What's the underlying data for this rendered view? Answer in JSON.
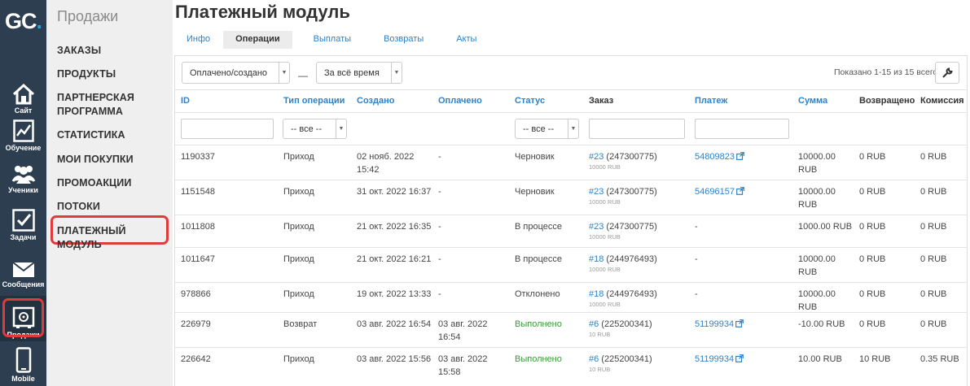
{
  "app": {
    "logo_g": "G",
    "logo_c": "C",
    "logo_dot": "."
  },
  "rail": [
    {
      "label": "Сайт",
      "icon": "house-icon"
    },
    {
      "label": "Обучение",
      "icon": "chart-icon"
    },
    {
      "label": "Ученики",
      "icon": "users-icon"
    },
    {
      "label": "Задачи",
      "icon": "checkbox-icon"
    },
    {
      "label": "Сообщения",
      "icon": "envelope-icon"
    },
    {
      "label": "Продажи",
      "icon": "safe-icon"
    },
    {
      "label": "Mobile",
      "icon": "phone-icon"
    }
  ],
  "menu": {
    "title": "Продажи",
    "items": [
      "ЗАКАЗЫ",
      "ПРОДУКТЫ",
      "ПАРТНЕРСКАЯ ПРОГРАММА",
      "СТАТИСТИКА",
      "МОИ ПОКУПКИ",
      "ПРОМОАКЦИИ",
      "ПОТОКИ",
      "ПЛАТЕЖНЫЙ МОДУЛЬ"
    ]
  },
  "page": {
    "title": "Платежный модуль"
  },
  "tabs": [
    "Инфо",
    "Операции",
    "Выплаты",
    "Возвраты",
    "Акты"
  ],
  "filters": {
    "status": "Оплачено/создано",
    "dash": "—",
    "period": "За всё время",
    "shown": "Показано 1-15 из 15 всего."
  },
  "table": {
    "headers": [
      "ID",
      "Тип операции",
      "Создано",
      "Оплачено",
      "Статус",
      "Заказ",
      "Платеж",
      "Сумма",
      "Возвращено",
      "Комиссия"
    ],
    "filter_type": "-- все --",
    "filter_status": "-- все --",
    "rows": [
      {
        "id": "1190337",
        "type": "Приход",
        "created1": "02 нояб. 2022",
        "created2": "15:42",
        "paid1": "-",
        "paid2": "",
        "status": "Черновик",
        "order": "#23",
        "order_rest": " (247300775)",
        "order_sub": "10000 RUB",
        "payment": "54809823",
        "sum1": "10000.00",
        "sum2": "RUB",
        "returned": "0 RUB",
        "commission": "0 RUB"
      },
      {
        "id": "1151548",
        "type": "Приход",
        "created1": "31 окт. 2022 16:37",
        "created2": "",
        "paid1": "-",
        "paid2": "",
        "status": "Черновик",
        "order": "#23",
        "order_rest": " (247300775)",
        "order_sub": "10000 RUB",
        "payment": "54696157",
        "sum1": "10000.00",
        "sum2": "RUB",
        "returned": "0 RUB",
        "commission": "0 RUB"
      },
      {
        "id": "1011808",
        "type": "Приход",
        "created1": "21 окт. 2022 16:35",
        "created2": "",
        "paid1": "-",
        "paid2": "",
        "status": "В процессе",
        "order": "#23",
        "order_rest": " (247300775)",
        "order_sub": "10000 RUB",
        "payment": "-",
        "sum1": "1000.00 RUB",
        "sum2": "",
        "returned": "0 RUB",
        "commission": "0 RUB"
      },
      {
        "id": "1011647",
        "type": "Приход",
        "created1": "21 окт. 2022 16:21",
        "created2": "",
        "paid1": "-",
        "paid2": "",
        "status": "В процессе",
        "order": "#18",
        "order_rest": " (244976493)",
        "order_sub": "10000 RUB",
        "payment": "-",
        "sum1": "10000.00",
        "sum2": "RUB",
        "returned": "0 RUB",
        "commission": "0 RUB"
      },
      {
        "id": "978866",
        "type": "Приход",
        "created1": "19 окт. 2022 13:33",
        "created2": "",
        "paid1": "-",
        "paid2": "",
        "status": "Отклонено",
        "order": "#18",
        "order_rest": " (244976493)",
        "order_sub": "10000 RUB",
        "payment": "-",
        "sum1": "10000.00",
        "sum2": "RUB",
        "returned": "0 RUB",
        "commission": "0 RUB"
      },
      {
        "id": "226979",
        "type": "Возврат",
        "created1": "03 авг. 2022 16:54",
        "created2": "",
        "paid1": "03 авг. 2022",
        "paid2": "16:54",
        "status": "Выполнено",
        "order": "#6",
        "order_rest": " (225200341)",
        "order_sub": "10 RUB",
        "payment": "51199934",
        "sum1": "-10.00 RUB",
        "sum2": "",
        "returned": "0 RUB",
        "commission": "0 RUB"
      },
      {
        "id": "226642",
        "type": "Приход",
        "created1": "03 авг. 2022 15:56",
        "created2": "",
        "paid1": "03 авг. 2022",
        "paid2": "15:58",
        "status": "Выполнено",
        "order": "#6",
        "order_rest": " (225200341)",
        "order_sub": "10 RUB",
        "payment": "51199934",
        "sum1": "10.00 RUB",
        "sum2": "",
        "returned": "10 RUB",
        "commission": "0.35 RUB"
      }
    ]
  },
  "colors": {
    "rail_bg": "#2c3e50",
    "link": "#2d82c9",
    "highlight": "#e03a3a",
    "success": "#3a9a3a"
  }
}
